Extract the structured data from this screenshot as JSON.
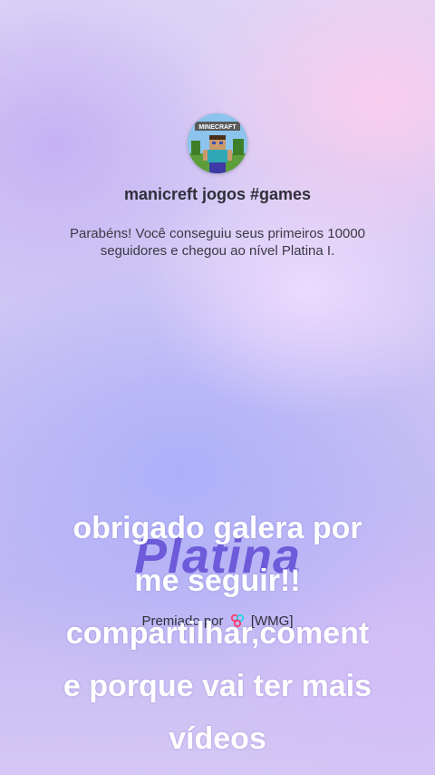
{
  "profile": {
    "avatar_text": "MINECRAFT",
    "username": "manicreft jogos #games"
  },
  "milestone": {
    "message": "Parabéns! Você conseguiu seus primeiros 10000 seguidores e chegou ao nível Platina I.",
    "level_name": "Platina",
    "footer_before": "Premiado por",
    "footer_after": "[WMG]"
  },
  "caption": {
    "text": "obrigado  galera  por\nme seguir!!\ncompartilhar,coment\ne   porque  vai ter mais\nvídeos"
  },
  "colors": {
    "level_accent": "#6a57d8",
    "caption_text": "#ffffff"
  }
}
